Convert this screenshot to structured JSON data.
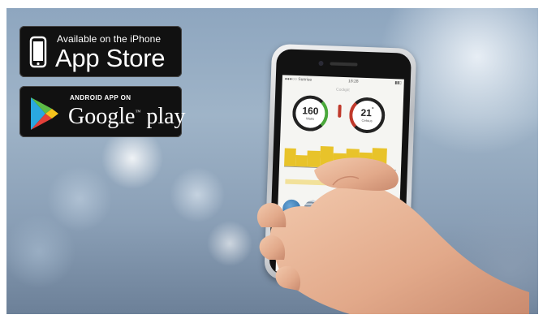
{
  "badges": {
    "apple": {
      "small_text": "Available on the iPhone",
      "big_text": "App Store"
    },
    "google": {
      "small_text": "ANDROID APP ON",
      "big_text": "Google",
      "big_text_suffix": "play",
      "trademark": "™"
    }
  },
  "phone_screen": {
    "status_left": "●●●○○ Sunrise",
    "status_time": "18:28",
    "status_right": "▮▮▯",
    "title": "Cockpit",
    "gauge_power": {
      "value": "160",
      "unit": "Watts"
    },
    "gauge_temp": {
      "value": "21",
      "degree": "°",
      "unit": "Celsius"
    },
    "page_dots": "● ● ○ ○ ○"
  },
  "colors": {
    "badge_bg": "#111111",
    "power_ring": "#4aa83b",
    "temp_ring": "#c0392b",
    "chart_bar": "#e8c32a",
    "home_button": "#3e8fd6"
  },
  "icons": [
    "apple-icon",
    "google-play-icon",
    "home-icon",
    "thermometer-icon"
  ]
}
